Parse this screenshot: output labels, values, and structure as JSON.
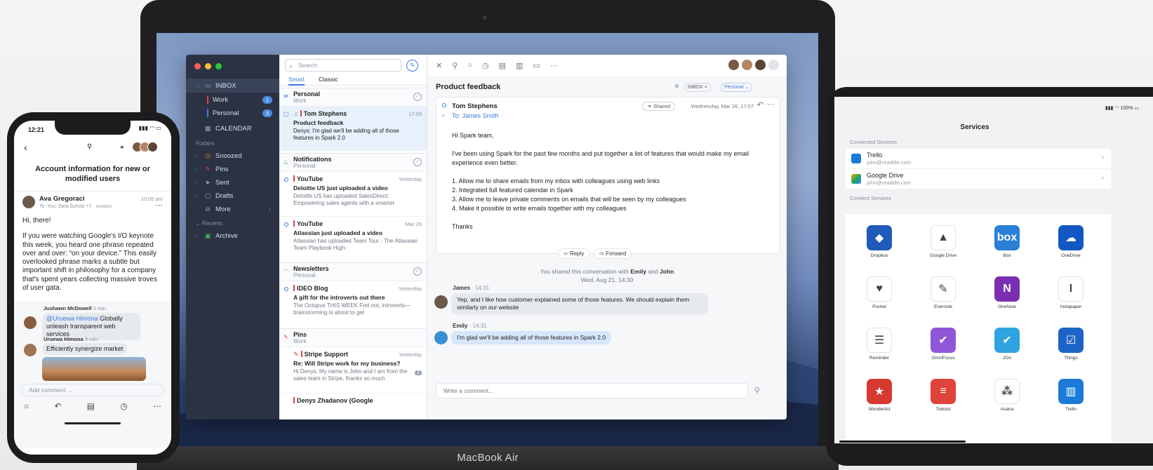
{
  "macbook": {
    "label": "MacBook Air",
    "sidebar": {
      "inbox": "INBOX",
      "work": "Work",
      "work_count": "1",
      "personal": "Personal",
      "personal_count": "3",
      "calendar": "CALENDAR",
      "folders_header": "Folders",
      "folders": [
        "Snoozed",
        "Pins",
        "Sent",
        "Drafts",
        "More"
      ],
      "recents_header": "Recents",
      "archive": "Archive"
    },
    "list": {
      "search_placeholder": "Search",
      "tab_smart": "Smart",
      "tab_classic": "Classic",
      "groups": [
        {
          "title": "Personal",
          "sub": "Work"
        },
        {
          "title": "Notifications",
          "sub": "Personal"
        },
        {
          "title": "Newsletters",
          "sub": "Personal"
        },
        {
          "title": "Pins",
          "sub": "Work"
        }
      ],
      "messages": [
        {
          "from": "Tom Stephens",
          "date": "17:09",
          "subject": "Product feedback",
          "preview": "Denys: I'm glad we'll be adding all of those features in Spark 2.0"
        },
        {
          "from": "YouTube",
          "date": "Yesterday",
          "subject": "Deloitte US just uploaded a video",
          "preview": "Deloitte US has uploaded SalesDirect: Empowering sales agents with a smarter"
        },
        {
          "from": "YouTube",
          "date": "Mar 26",
          "subject": "Atlassian just uploaded a video",
          "preview": "Atlassian has uploaded Team Tour - The Atlassian Team Playbook High-"
        },
        {
          "from": "IDEO Blog",
          "date": "Yesterday",
          "subject": "A gift for the introverts out there",
          "preview": "The Octopus THIS WEEK Fret not, introverts—brainstorming is about to get"
        },
        {
          "from": "Stripe Support",
          "date": "Yesterday",
          "subject": "Re: Will Stripe work for my business?",
          "preview": "Hi Denys, My name is John and I am from the sales team in Stripe, thanks so much",
          "count": "2"
        }
      ],
      "next_from": "Denys Zhadanov (Google"
    },
    "reader": {
      "title": "Product feedback",
      "chip_inbox": "INBOX ×",
      "chip_personal": "Personal ⌄",
      "from": "Tom Stephens",
      "to": "To: James Smith",
      "shared": "Shared",
      "date": "Wednesday, Mar 28, 17:07",
      "body": [
        "Hi Spark team,",
        "I've been using Spark for the past few months and put together a list of features that would make my email experience even better.",
        "1. Allow me to share emails from my inbox with colleagues using web links\n2. Integrated full featured calendar in Spark\n3. Allow me to leave private comments on emails that will be seen by my colleagues\n4. Make it possible to write emails together with my colleagues",
        "Thanks"
      ],
      "reply": "Reply",
      "forward": "Forward",
      "shared_prefix": "You shared this conversation with ",
      "shared_name1": "Emily",
      "shared_and": " and ",
      "shared_name2": "John",
      "shared_date": "Wed, Aug 21, 14:30",
      "comments": [
        {
          "name": "James",
          "time": " · 14:31",
          "text": "Yep, and I like how customer explained some of those features. We should explain them similarly on our website"
        },
        {
          "name": "Emily",
          "time": " · 14:31",
          "text": "I'm glad we'll be adding all of those features in Spark 2.0"
        }
      ],
      "comment_placeholder": "Write a comment..."
    }
  },
  "iphone": {
    "time": "12:21",
    "title": "Account information for new or modified users",
    "sender": "Ava Gregoraci",
    "sender_time": "10:00 am",
    "recipients": "To: You, Sara Scholz +7",
    "shared_tag": "SHARED",
    "body": [
      "Hi, there!",
      "If you were watching Google's I/O keynote this week, you heard one phrase repeated over and over: “on your device.” This easily overlooked phrase marks a subtle but important shift in philosophy for a company that's spent years collecting massive troves of user gata."
    ],
    "comment1_name": "Jushawn McDowell",
    "comment1_time": "5 min",
    "comment1_mention": "@Uruewa Himona",
    "comment1_text": " Globally unleash transparent web services",
    "comment2_name": "Uruewa Himona",
    "comment2_time": "3 min",
    "comment2_text": "Efficiently synergize market",
    "comment_placeholder": "Add comment ..."
  },
  "ipad": {
    "status": "100%",
    "title": "Services",
    "connected_header": "Connected Services",
    "connected": [
      {
        "name": "Trello",
        "email": "john@readdle.com",
        "color": "#1d7bd8"
      },
      {
        "name": "Google Drive",
        "email": "john@readdle.com",
        "color": "#f5b400"
      }
    ],
    "connect_header": "Connect Services",
    "services": [
      {
        "name": "Dropbox",
        "color": "#1f5bb8",
        "glyph": "◆"
      },
      {
        "name": "Google Drive",
        "color": "#ffffff",
        "glyph": "▲"
      },
      {
        "name": "Box",
        "color": "#2a7fd6",
        "glyph": "box"
      },
      {
        "name": "OneDrive",
        "color": "#1357c4",
        "glyph": "☁"
      },
      {
        "name": "Pocket",
        "color": "#ffffff",
        "glyph": "♥"
      },
      {
        "name": "Evernote",
        "color": "#ffffff",
        "glyph": "✎"
      },
      {
        "name": "OneNote",
        "color": "#7a2fb3",
        "glyph": "N"
      },
      {
        "name": "Instapaper",
        "color": "#ffffff",
        "glyph": "I"
      },
      {
        "name": "Reminder",
        "color": "#ffffff",
        "glyph": "☰"
      },
      {
        "name": "OmniFocus",
        "color": "#8d57d8",
        "glyph": "✔"
      },
      {
        "name": "2Do",
        "color": "#2ea3df",
        "glyph": "✔"
      },
      {
        "name": "Things",
        "color": "#1c64c8",
        "glyph": "☑"
      },
      {
        "name": "Wunderlist",
        "color": "#d6392f",
        "glyph": "★"
      },
      {
        "name": "Todoist",
        "color": "#e0433a",
        "glyph": "≡"
      },
      {
        "name": "Asana",
        "color": "#ffffff",
        "glyph": "⁂"
      },
      {
        "name": "Trello",
        "color": "#1d7bd8",
        "glyph": "▥"
      }
    ]
  }
}
